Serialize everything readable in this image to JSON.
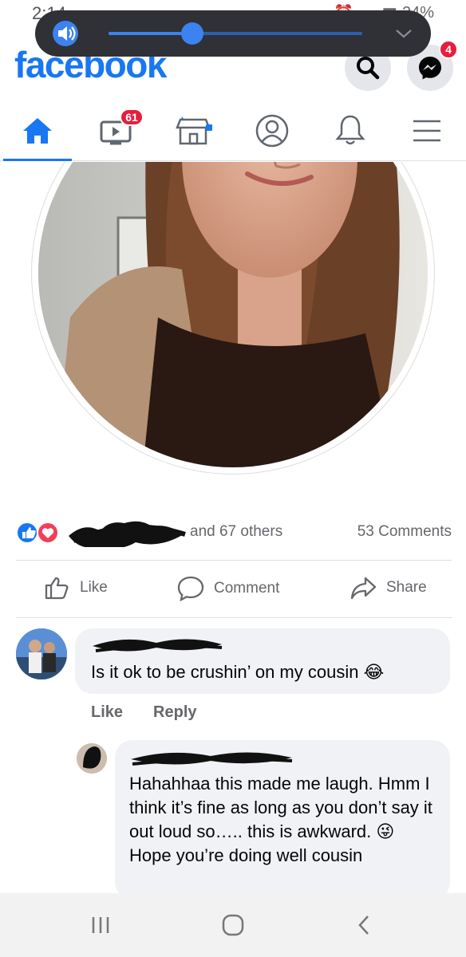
{
  "status_bar": {
    "time": "2:14",
    "battery": "24%"
  },
  "header": {
    "logo": "facebook",
    "messenger_badge": "4"
  },
  "tabs": [
    {
      "name": "home",
      "icon": "home-icon",
      "active": true
    },
    {
      "name": "watch",
      "icon": "video-icon",
      "badge": "61"
    },
    {
      "name": "marketplace",
      "icon": "marketplace-icon"
    },
    {
      "name": "profile",
      "icon": "profile-icon"
    },
    {
      "name": "notifications",
      "icon": "bell-icon"
    },
    {
      "name": "menu",
      "icon": "menu-icon"
    }
  ],
  "volume": {
    "level": 0.33
  },
  "post": {
    "reactions_text": "and 67 others",
    "comments_count": "53 Comments",
    "like_label": "Like",
    "comment_label": "Comment",
    "share_label": "Share"
  },
  "comments": [
    {
      "text": "Is it ok to be crushin’ on my cousin",
      "emoji": "😂",
      "like_label": "Like",
      "reply_label": "Reply"
    },
    {
      "text": "Hahahhaa this made me laugh. Hmm I think it’s fine as long as you don’t say it out loud so….. this is awkward. 😜 Hope you’re doing well cousin"
    }
  ],
  "colors": {
    "brand": "#1877f2",
    "badge": "#e41e3f",
    "muted": "#65676b",
    "bubble": "#f0f2f5"
  }
}
